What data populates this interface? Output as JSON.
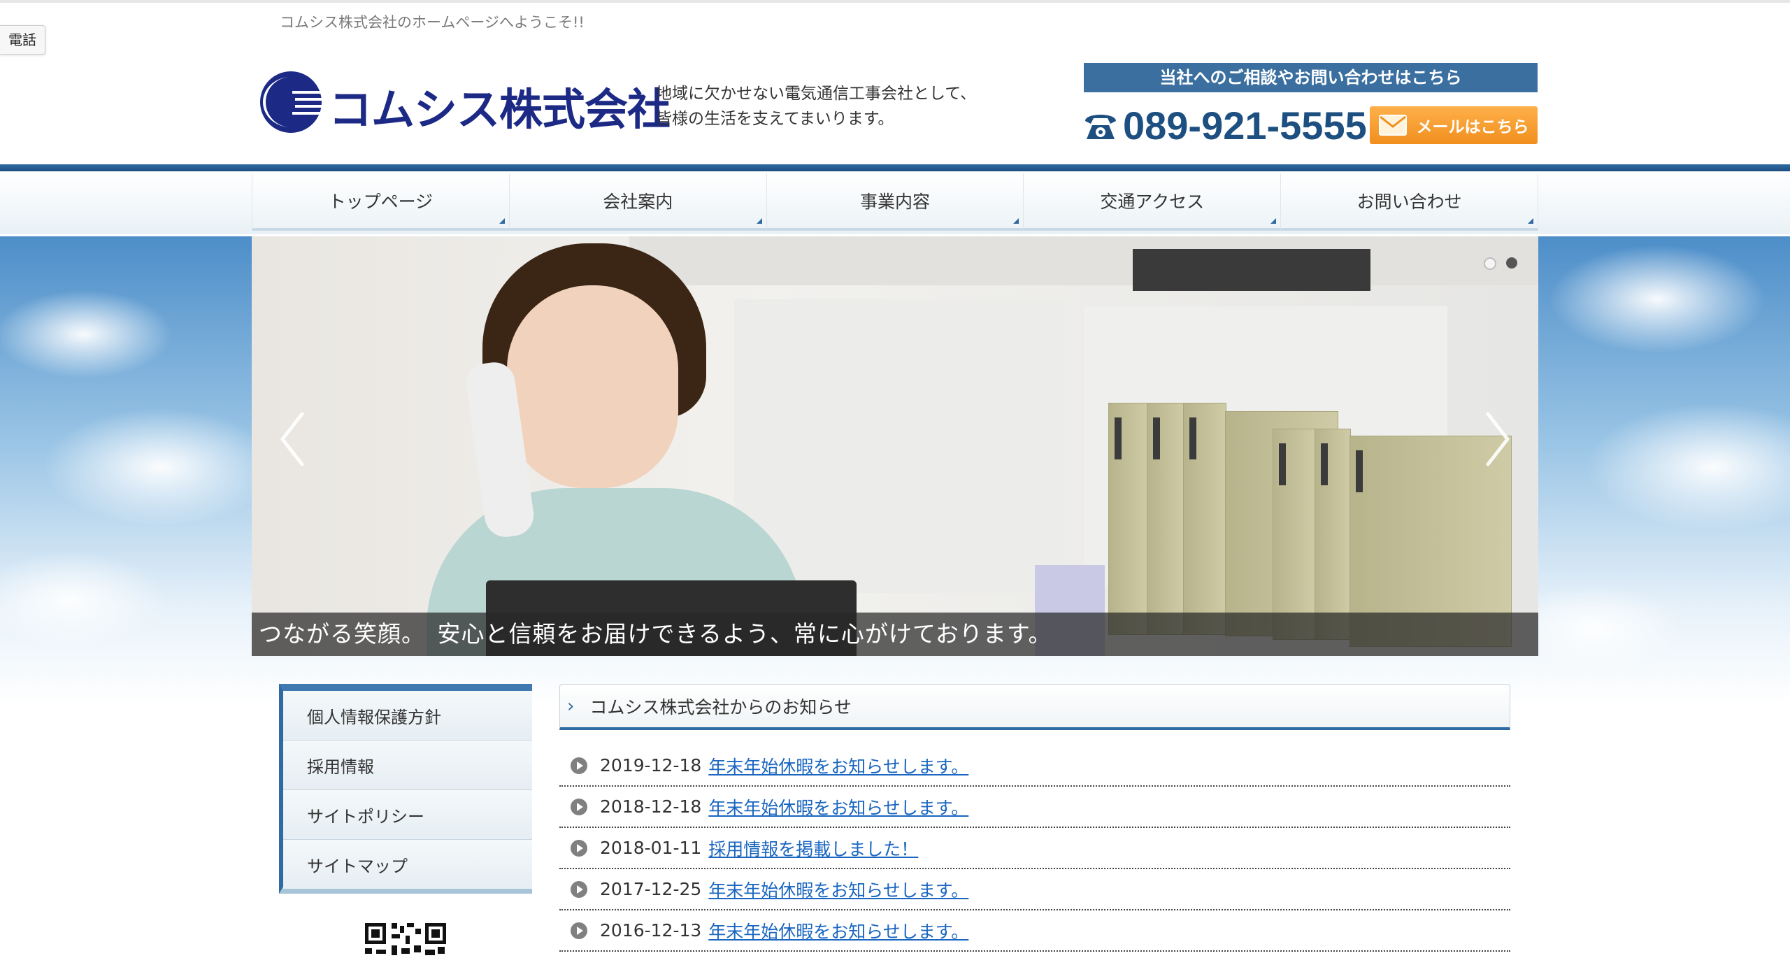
{
  "header": {
    "welcome": "コムシス株式会社のホームページへようこそ!!",
    "phone_tab": "電話",
    "company_name": "コムシス株式会社",
    "tagline_line1": "地域に欠かせない電気通信工事会社として、",
    "tagline_line2": "皆様の生活を支えてまいります。",
    "contact_banner": "当社へのご相談やお問い合わせはこちら",
    "tel": "089-921-5555",
    "mail_button": "メールはこちら"
  },
  "nav": [
    {
      "label": "トップページ"
    },
    {
      "label": "会社案内"
    },
    {
      "label": "事業内容"
    },
    {
      "label": "交通アクセス"
    },
    {
      "label": "お問い合わせ"
    }
  ],
  "slider": {
    "caption": "つながる笑顔。　安心と信頼をお届けできるよう、常に心がけております。",
    "slide_count": 2,
    "active_slide": 2
  },
  "sidebar": {
    "items": [
      {
        "label": "個人情報保護方針"
      },
      {
        "label": "採用情報"
      },
      {
        "label": "サイトポリシー"
      },
      {
        "label": "サイトマップ"
      }
    ]
  },
  "news": {
    "title": "コムシス株式会社からのお知らせ",
    "items": [
      {
        "date": "2019-12-18",
        "title": "年末年始休暇をお知らせします。"
      },
      {
        "date": "2018-12-18",
        "title": "年末年始休暇をお知らせします。"
      },
      {
        "date": "2018-01-11",
        "title": "採用情報を掲載しました！"
      },
      {
        "date": "2017-12-25",
        "title": "年末年始休暇をお知らせします。"
      },
      {
        "date": "2016-12-13",
        "title": "年末年始休暇をお知らせします。"
      }
    ]
  },
  "colors": {
    "brand_blue": "#1c2a86",
    "nav_blue": "#2f6aa2",
    "mail_orange": "#f08f1e",
    "link": "#1a66c0"
  }
}
